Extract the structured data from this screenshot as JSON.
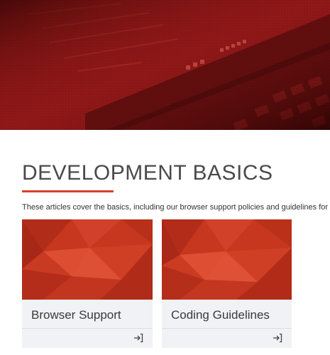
{
  "hero": {
    "image": "laptop-keyboard-red-photo"
  },
  "section": {
    "title": "DEVELOPMENT BASICS",
    "description": "These articles cover the basics, including our browser support policies and guidelines for"
  },
  "cards": [
    {
      "title": "Browser Support",
      "icon": "arrow-into-box-icon"
    },
    {
      "title": "Coding Guidelines",
      "icon": "arrow-into-box-icon"
    }
  ],
  "colors": {
    "accent": "#d9412e",
    "card_background": "#f1f2f5",
    "card_image": "#c7361f",
    "hero_tint": "#8b1616"
  }
}
